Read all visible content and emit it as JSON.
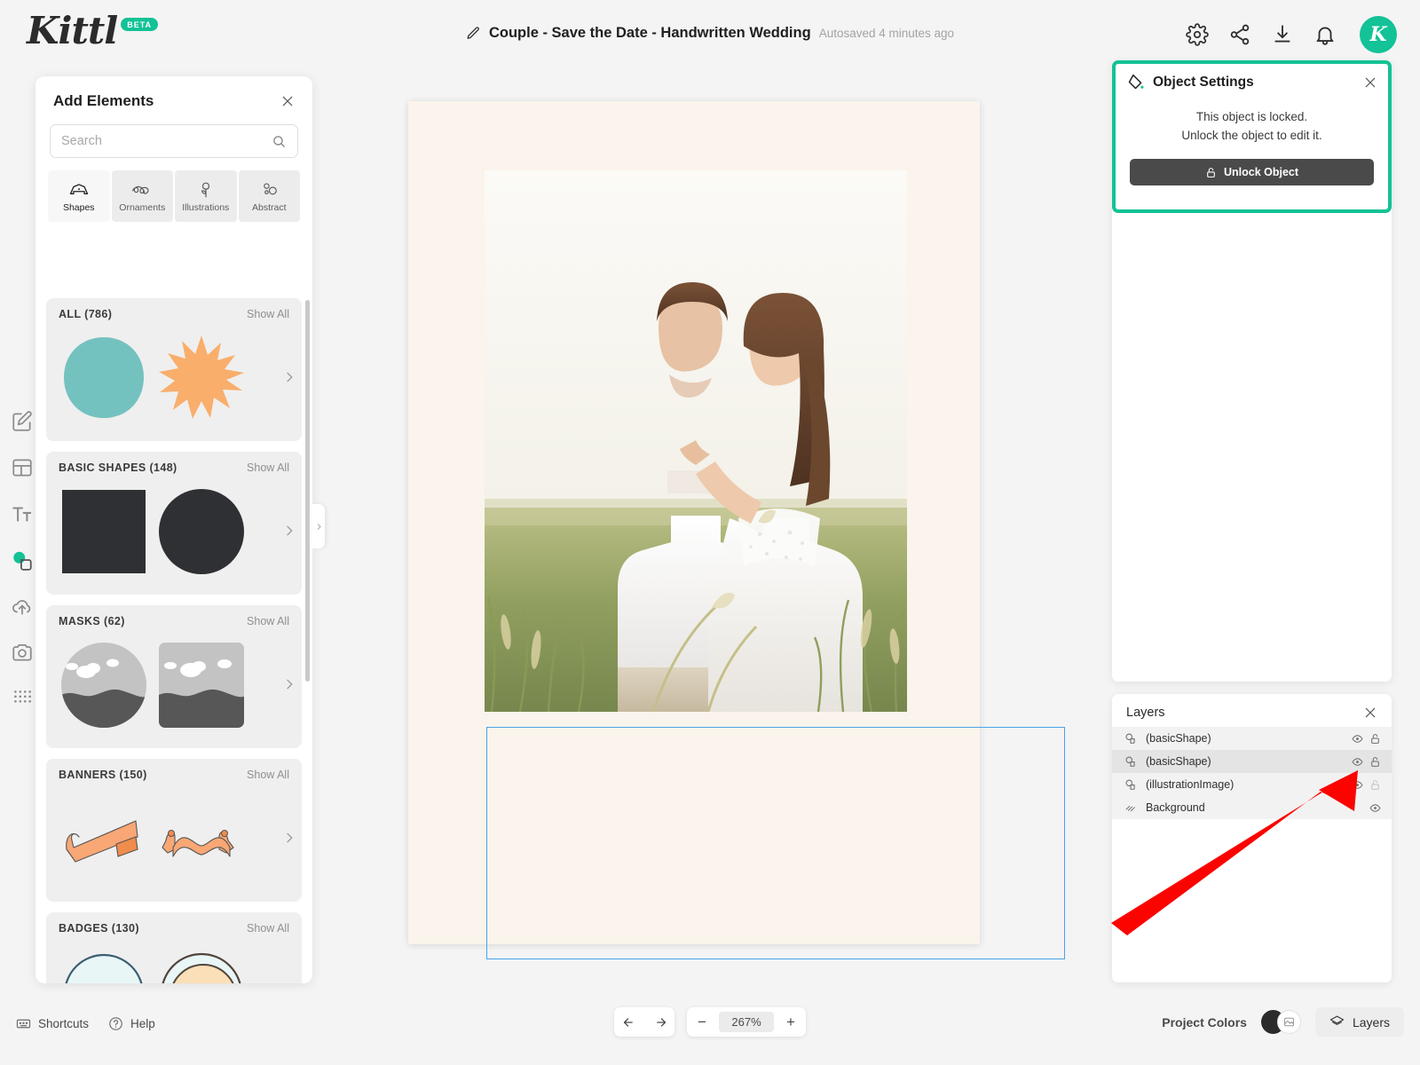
{
  "app": {
    "logo_text": "Kittl",
    "beta_label": "BETA"
  },
  "header": {
    "doc_title": "Couple - Save the Date - Handwritten Wedding",
    "autosaved": "Autosaved 4 minutes ago",
    "icons": [
      "gear-icon",
      "share-icon",
      "download-icon",
      "bell-icon"
    ],
    "avatar_initial": "K",
    "accent_color": "#13c296"
  },
  "left_rail": {
    "items": [
      {
        "name": "edit-tool",
        "icon": "pencil-square-icon",
        "active": false
      },
      {
        "name": "templates-tool",
        "icon": "layout-icon",
        "active": false
      },
      {
        "name": "text-tool",
        "icon": "text-icon",
        "active": false
      },
      {
        "name": "elements-tool",
        "icon": "shapes-icon",
        "active": true
      },
      {
        "name": "uploads-tool",
        "icon": "upload-cloud-icon",
        "active": false
      },
      {
        "name": "photos-tool",
        "icon": "camera-icon",
        "active": false
      },
      {
        "name": "apps-tool",
        "icon": "grid-dots-icon",
        "active": false
      }
    ]
  },
  "elements_panel": {
    "title": "Add Elements",
    "search_placeholder": "Search",
    "search_value": "",
    "tabs": [
      {
        "label": "Shapes",
        "icon": "shapes-icon",
        "active": true
      },
      {
        "label": "Ornaments",
        "icon": "swirl-icon",
        "active": false
      },
      {
        "label": "Illustrations",
        "icon": "flower-icon",
        "active": false
      },
      {
        "label": "Abstract",
        "icon": "abstract-circles-icon",
        "active": false
      }
    ],
    "show_all_label": "Show All",
    "categories": [
      {
        "title": "ALL (786)",
        "kind": "all"
      },
      {
        "title": "BASIC SHAPES (148)",
        "kind": "basic"
      },
      {
        "title": "MASKS (62)",
        "kind": "masks"
      },
      {
        "title": "BANNERS (150)",
        "kind": "banners"
      },
      {
        "title": "BADGES (130)",
        "kind": "badges"
      }
    ]
  },
  "object_settings": {
    "title": "Object Settings",
    "locked_line1": "This object is locked.",
    "locked_line2": "Unlock the object to edit it.",
    "unlock_button": "Unlock Object",
    "highlight_color": "#13c295"
  },
  "layers_panel": {
    "title": "Layers",
    "rows": [
      {
        "name": "(basicShape)",
        "selected": false,
        "visible": true,
        "locked": true
      },
      {
        "name": "(basicShape)",
        "selected": true,
        "visible": true,
        "locked": true
      },
      {
        "name": "(illustrationImage)",
        "selected": false,
        "visible": true,
        "locked": false
      },
      {
        "name": "Background",
        "selected": false,
        "visible": true,
        "locked": false
      }
    ]
  },
  "bottom_bar": {
    "shortcuts_label": "Shortcuts",
    "help_label": "Help",
    "zoom_level": "267%",
    "zoom_out_label": "−",
    "zoom_in_label": "+",
    "project_colors_label": "Project Colors",
    "layers_button_label": "Layers",
    "swatch_colors": [
      "#2b2b2b",
      "#ffffff"
    ]
  },
  "canvas": {
    "artboard_bg": "#faf4ec",
    "selection_color": "#4aa3e8",
    "photo_alt": "wedding-couple-photo"
  }
}
